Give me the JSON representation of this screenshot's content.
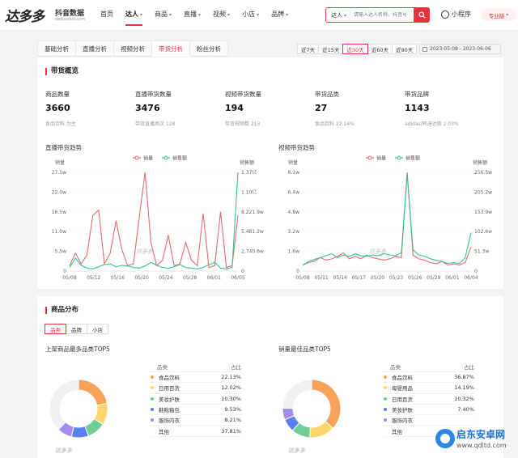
{
  "header": {
    "logo_main": "达多多",
    "logo_sub": "抖音数据",
    "logo_url": "daduoduo.com",
    "nav": [
      {
        "label": "首页",
        "caret": ""
      },
      {
        "label": "达人",
        "caret": "▾"
      },
      {
        "label": "商品",
        "caret": "▾"
      },
      {
        "label": "直播",
        "caret": "▾"
      },
      {
        "label": "视频",
        "caret": "▾"
      },
      {
        "label": "小店",
        "caret": "▾"
      },
      {
        "label": "品牌",
        "caret": "▾"
      }
    ],
    "search_type": "达人",
    "search_placeholder": "请输入达人名称、抖音号",
    "mini_program": "小程序",
    "pro_badge": "专业版"
  },
  "tabs": [
    "基础分析",
    "直播分析",
    "视频分析",
    "带货分析",
    "粉丝分析"
  ],
  "active_tab": 3,
  "ranges": [
    "近7天",
    "近15天",
    "近30天",
    "近60天",
    "近90天"
  ],
  "active_range": 2,
  "date_range": "2023-05-08 - 2023-06-06",
  "overview": {
    "title": "带货概览",
    "stats": [
      {
        "label": "商品数量",
        "value": "3660",
        "sub": "食品饮料 为主"
      },
      {
        "label": "直播带货数量",
        "value": "3476",
        "sub": "带货直播场次 128"
      },
      {
        "label": "视频带货数量",
        "value": "194",
        "sub": "带货视频数 213"
      },
      {
        "label": "带货品类",
        "value": "27",
        "sub": "食品饮料 22.14%"
      },
      {
        "label": "带货品牌",
        "value": "1143",
        "sub": "adidas/阿迪达斯 2.03%"
      }
    ]
  },
  "colors": {
    "sales": "#e86a6e",
    "amount": "#32c496",
    "accent": "#e6343e"
  },
  "chart_data": [
    {
      "type": "line",
      "title": "直播带货趋势",
      "legend": [
        "销量",
        "销售额"
      ],
      "ylabel_left": "销量",
      "ylabel_right": "销售额",
      "x_ticks": [
        "05/08",
        "05/12",
        "05/16",
        "05/20",
        "05/24",
        "05/28",
        "06/01",
        "06/05"
      ],
      "y_left_ticks": [
        "27.5w",
        "22.0w",
        "16.5w",
        "11.0w",
        "5.5w",
        "0"
      ],
      "y_right_ticks": [
        "1.37亿",
        "1.10亿",
        "8,221.9w",
        "5,481.2w",
        "2,740.6w",
        "0"
      ],
      "ylim_left": [
        0,
        27.5
      ],
      "ylim_right": [
        0,
        1.37
      ],
      "series": [
        {
          "name": "销量",
          "unit": "w",
          "values": [
            1.5,
            5.0,
            2.0,
            4.5,
            15.5,
            17.0,
            2.0,
            5.0,
            14.0,
            6.0,
            1.5,
            2.0,
            15.0,
            27.5,
            8.0,
            1.5,
            3.0,
            10.0,
            1.5,
            2.0,
            8.0,
            3.0,
            1.5,
            16.0,
            1.0,
            1.5,
            16.5,
            1.0,
            1.5,
            15.5
          ]
        },
        {
          "name": "销售额",
          "unit": "亿",
          "values": [
            0.05,
            0.18,
            0.08,
            0.04,
            0.03,
            0.06,
            0.09,
            0.1,
            0.06,
            0.08,
            0.07,
            0.05,
            0.04,
            0.07,
            0.12,
            0.08,
            0.05,
            0.04,
            0.06,
            0.09,
            0.05,
            0.04,
            0.03,
            0.05,
            0.09,
            0.12,
            0.04,
            0.03,
            0.05,
            1.37
          ]
        }
      ]
    },
    {
      "type": "line",
      "title": "视频带货趋势",
      "legend": [
        "销量",
        "销售额"
      ],
      "ylabel_left": "销量",
      "ylabel_right": "销售额",
      "x_ticks": [
        "05/08",
        "05/11",
        "05/14",
        "05/17",
        "05/20",
        "05/23",
        "05/26",
        "05/29",
        "06/01",
        "06/04"
      ],
      "y_left_ticks": [
        "8.1w",
        "6.4w",
        "4.8w",
        "3.2w",
        "1.6w",
        "0"
      ],
      "y_right_ticks": [
        "256.5w",
        "205.2w",
        "153.9w",
        "102.6w",
        "51.3w",
        "0"
      ],
      "ylim_left": [
        0,
        8.1
      ],
      "ylim_right": [
        0,
        256.5
      ],
      "series": [
        {
          "name": "销量",
          "unit": "w",
          "values": [
            0.5,
            0.7,
            0.8,
            1.1,
            0.9,
            1.0,
            1.2,
            1.5,
            1.0,
            1.2,
            1.0,
            1.3,
            1.1,
            1.0,
            0.9,
            1.0,
            1.2,
            1.1,
            8.1,
            1.3,
            1.0,
            0.9,
            0.7,
            0.6,
            0.8,
            0.5,
            0.6,
            0.5,
            0.7,
            2.0
          ]
        },
        {
          "name": "销售额",
          "unit": "w",
          "values": [
            15,
            25,
            30,
            35,
            40,
            45,
            35,
            42,
            38,
            45,
            40,
            38,
            42,
            40,
            45,
            42,
            40,
            48,
            252,
            55,
            42,
            38,
            32,
            28,
            25,
            20,
            22,
            20,
            35,
            100
          ]
        }
      ]
    },
    {
      "type": "pie",
      "title": "上架商品最多品类TOP5",
      "categories": [
        "食品饮料",
        "日用百货",
        "美妆护肤",
        "鞋靴箱包",
        "服饰内衣",
        "其他"
      ],
      "values": [
        22.13,
        12.02,
        10.3,
        9.53,
        8.21,
        37.81
      ],
      "labels": [
        "22.13%",
        "12.02%",
        "10.30%",
        "9.53%",
        "8.21%",
        "37.81%"
      ],
      "colors": [
        "#f7a25a",
        "#ffd66b",
        "#6fcf97",
        "#5b7ef5",
        "#a58cf0",
        "#f0f0f0"
      ]
    },
    {
      "type": "pie",
      "title": "销量最佳品类TOP5",
      "categories": [
        "食品饮料",
        "母婴用品",
        "日用百货",
        "美妆护肤",
        "服饰内衣",
        "其他"
      ],
      "values": [
        36.87,
        14.19,
        10.32,
        7.4,
        6.5,
        24.72
      ],
      "labels": [
        "36.87%",
        "14.19%",
        "10.32%",
        "7.40%",
        "",
        ""
      ],
      "colors": [
        "#f7a25a",
        "#ffd66b",
        "#6fcf97",
        "#5b7ef5",
        "#a58cf0",
        "#f0f0f0"
      ]
    }
  ],
  "distribution": {
    "title": "商品分布",
    "sub_tabs": [
      "品类",
      "品牌",
      "小店"
    ],
    "active_sub": 0,
    "col_category": "品类",
    "col_share": "占比"
  },
  "chart_watermark": "达多多",
  "site_watermark": {
    "brand": "启东安卓网",
    "url": "www.qdltd.com"
  }
}
